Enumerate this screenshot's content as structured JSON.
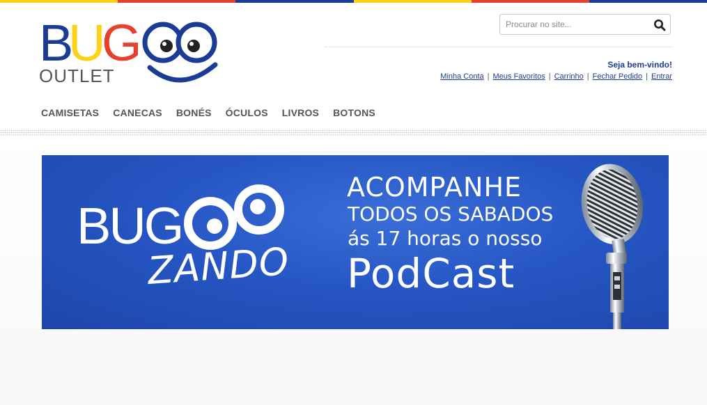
{
  "colors": {
    "topbar": [
      "#fcd116",
      "#e8402f",
      "#1b3c94",
      "#fcd116",
      "#e8402f",
      "#1b3c94"
    ],
    "logo_blue": "#1b3c94",
    "logo_yellow": "#fcd116",
    "logo_red": "#e8402f",
    "link": "#1b3c94"
  },
  "logo": {
    "letters": [
      "B",
      "U",
      "G"
    ],
    "subtitle": "OUTLET"
  },
  "search": {
    "placeholder": "Procurar no site...",
    "icon": "search-icon"
  },
  "header": {
    "welcome": "Seja bem-vindo!",
    "links": [
      "Minha Conta",
      "Meus Favoritos",
      "Carrinho",
      "Fechar Pedido",
      "Entrar"
    ],
    "separator": "|"
  },
  "nav": {
    "items": [
      "CAMISETAS",
      "CANECAS",
      "BONÉS",
      "ÓCULOS",
      "LIVROS",
      "BOTONS"
    ]
  },
  "banner": {
    "brand_top": "BUG",
    "brand_bottom": "ZANDO",
    "line1": "ACOMPANHE",
    "line2": "TODOS OS SABADOS",
    "line3": "ás 17 horas o nosso",
    "line4": "PodCast",
    "icon": "microphone-icon"
  }
}
